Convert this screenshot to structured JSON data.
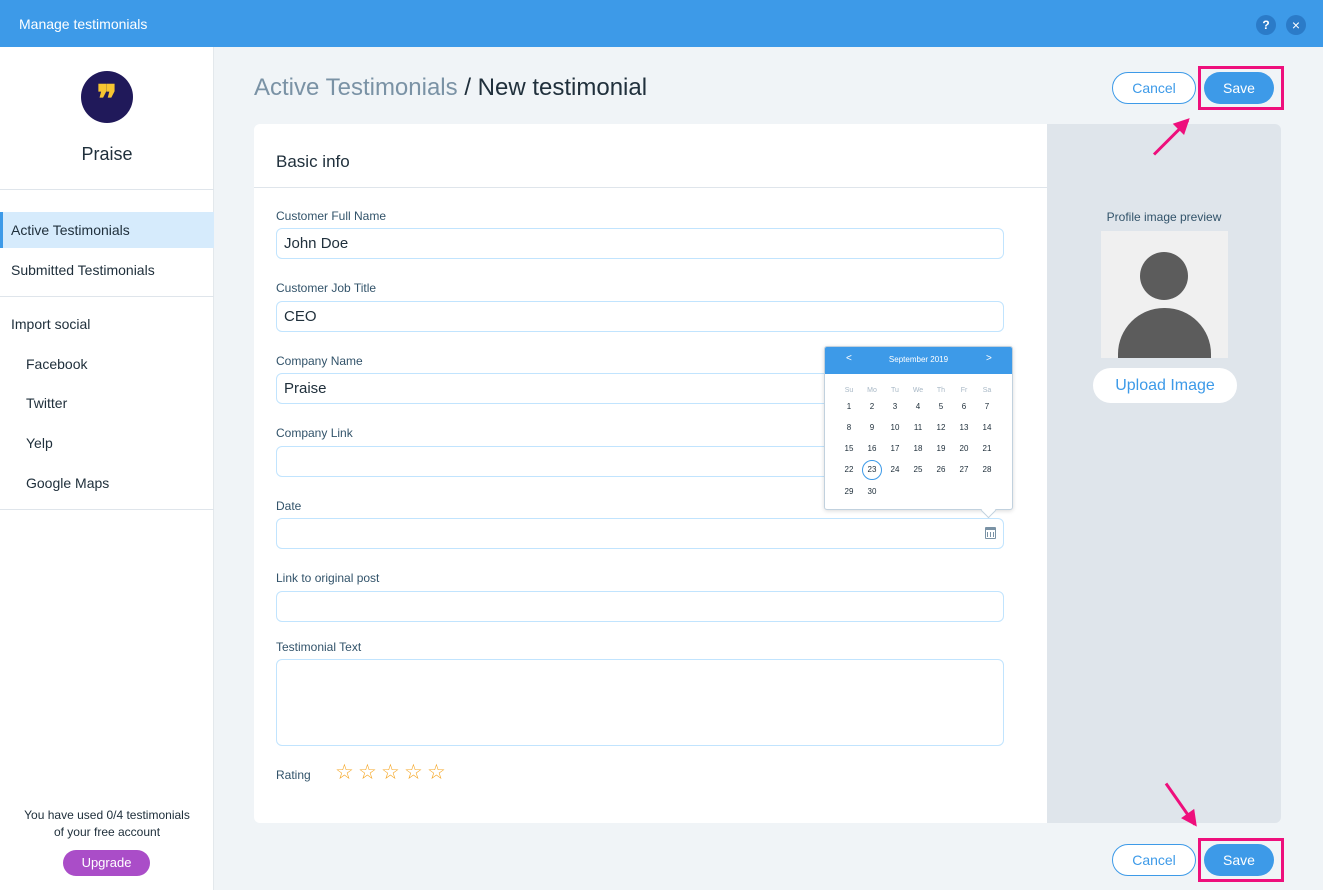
{
  "window": {
    "title": "Manage testimonials",
    "help_label": "?",
    "close_label": "×"
  },
  "sidebar": {
    "logo_glyph": "❞",
    "brand": "Praise",
    "items": [
      {
        "label": "Active Testimonials",
        "active": true
      },
      {
        "label": "Submitted Testimonials",
        "active": false
      }
    ],
    "import_section": {
      "label": "Import social",
      "items": [
        {
          "label": "Facebook"
        },
        {
          "label": "Twitter"
        },
        {
          "label": "Yelp"
        },
        {
          "label": "Google Maps"
        }
      ]
    },
    "usage_line1": "You have used 0/4 testimonials",
    "usage_line2": "of your free account",
    "upgrade_label": "Upgrade"
  },
  "header": {
    "breadcrumb_parent": "Active Testimonials",
    "breadcrumb_separator": "/",
    "breadcrumb_current": "New testimonial",
    "cancel_label": "Cancel",
    "save_label": "Save"
  },
  "form": {
    "section_title": "Basic info",
    "fields": {
      "full_name": {
        "label": "Customer Full Name",
        "value": "John Doe"
      },
      "job_title": {
        "label": "Customer Job Title",
        "value": "CEO"
      },
      "company": {
        "label": "Company Name",
        "value": "Praise"
      },
      "company_link": {
        "label": "Company Link",
        "value": ""
      },
      "date": {
        "label": "Date",
        "value": ""
      },
      "original_post": {
        "label": "Link to original post",
        "value": ""
      },
      "text": {
        "label": "Testimonial Text",
        "value": ""
      }
    },
    "rating": {
      "label": "Rating",
      "value": 0,
      "max": 5
    }
  },
  "preview": {
    "label": "Profile image preview",
    "upload_label": "Upload Image"
  },
  "calendar": {
    "prev_label": "<",
    "next_label": ">",
    "month_label": "September 2019",
    "weekdays": [
      "Su",
      "Mo",
      "Tu",
      "We",
      "Th",
      "Fr",
      "Sa"
    ],
    "weeks": [
      [
        "1",
        "2",
        "3",
        "4",
        "5",
        "6",
        "7"
      ],
      [
        "8",
        "9",
        "10",
        "11",
        "12",
        "13",
        "14"
      ],
      [
        "15",
        "16",
        "17",
        "18",
        "19",
        "20",
        "21"
      ],
      [
        "22",
        "23",
        "24",
        "25",
        "26",
        "27",
        "28"
      ],
      [
        "29",
        "30"
      ]
    ],
    "selected_day": "23"
  },
  "footer": {
    "cancel_label": "Cancel",
    "save_label": "Save"
  },
  "colors": {
    "accent": "#3d9ae8",
    "highlight": "#ee0f7c",
    "upgrade": "#aa4dc8",
    "logo_bg": "#20195a",
    "logo_glyph": "#f7c531",
    "star": "#f5a623"
  }
}
